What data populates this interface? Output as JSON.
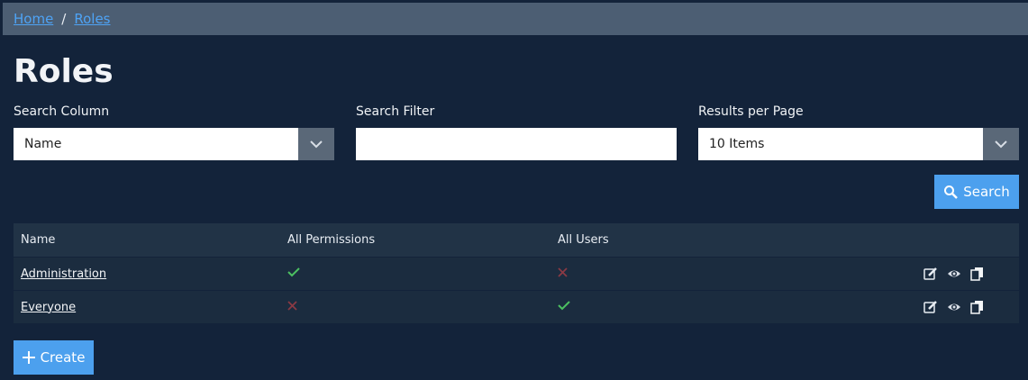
{
  "breadcrumb": {
    "home": "Home",
    "separator": "/",
    "current": "Roles"
  },
  "page": {
    "title": "Roles"
  },
  "filters": {
    "search_column": {
      "label": "Search Column",
      "value": "Name"
    },
    "search_filter": {
      "label": "Search Filter",
      "value": "",
      "placeholder": ""
    },
    "results_per_page": {
      "label": "Results per Page",
      "value": "10 Items"
    }
  },
  "buttons": {
    "search": "Search",
    "create": "Create"
  },
  "table": {
    "headers": [
      "Name",
      "All Permissions",
      "All Users"
    ],
    "rows": [
      {
        "name": "Administration",
        "all_permissions": true,
        "all_users": false
      },
      {
        "name": "Everyone",
        "all_permissions": false,
        "all_users": true
      }
    ]
  },
  "colors": {
    "background": "#13233a",
    "breadcrumb_bg": "#4c5e73",
    "accent": "#4ca0ee",
    "check": "#4cc061",
    "cross": "#8a3a44"
  },
  "icons": [
    "chevron-down-icon",
    "search-icon",
    "check-icon",
    "cross-icon",
    "edit-icon",
    "view-icon",
    "copy-icon",
    "plus-icon"
  ]
}
